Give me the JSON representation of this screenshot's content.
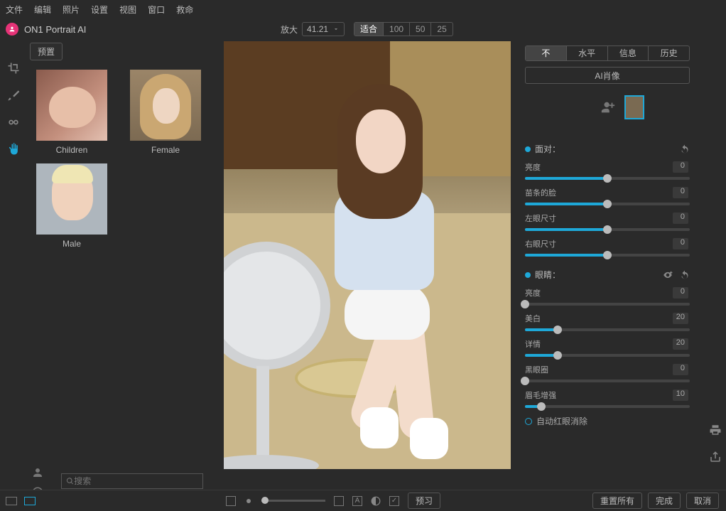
{
  "menu": {
    "items": [
      "文件",
      "编辑",
      "照片",
      "设置",
      "视图",
      "窗口",
      "救命"
    ]
  },
  "app": {
    "title": "ON1 Portrait AI"
  },
  "zoom": {
    "label": "放大",
    "value": "41.21"
  },
  "fit": {
    "options": [
      "适合",
      "100",
      "50",
      "25"
    ],
    "selected_index": 0
  },
  "left": {
    "preset_tab": "预置",
    "presets": [
      {
        "name": "Children",
        "thumb": "children"
      },
      {
        "name": "Female",
        "thumb": "female"
      },
      {
        "name": "Male",
        "thumb": "male"
      }
    ],
    "search_placeholder": "搜索"
  },
  "right": {
    "tabs": [
      "不",
      "水平",
      "信息",
      "历史"
    ],
    "tab_selected": 0,
    "ai_button": "AI肖像",
    "sections": {
      "face": {
        "title": "面对：",
        "sliders": [
          {
            "label": "亮度",
            "value": 0,
            "percent": 50
          },
          {
            "label": "苗条的脸",
            "value": 0,
            "percent": 50
          },
          {
            "label": "左眼尺寸",
            "value": 0,
            "percent": 50
          },
          {
            "label": "右眼尺寸",
            "value": 0,
            "percent": 50
          }
        ]
      },
      "eyes": {
        "title": "眼睛：",
        "sliders": [
          {
            "label": "亮度",
            "value": 0,
            "percent": 0
          },
          {
            "label": "美白",
            "value": 20,
            "percent": 20
          },
          {
            "label": "详情",
            "value": 20,
            "percent": 20
          },
          {
            "label": "黑眼圈",
            "value": 0,
            "percent": 0
          },
          {
            "label": "眉毛增强",
            "value": 10,
            "percent": 10
          }
        ],
        "auto_red": "自动红眼消除"
      }
    }
  },
  "bottom": {
    "preview": "预习",
    "reset": "重置所有",
    "done": "完成",
    "cancel": "取消"
  }
}
